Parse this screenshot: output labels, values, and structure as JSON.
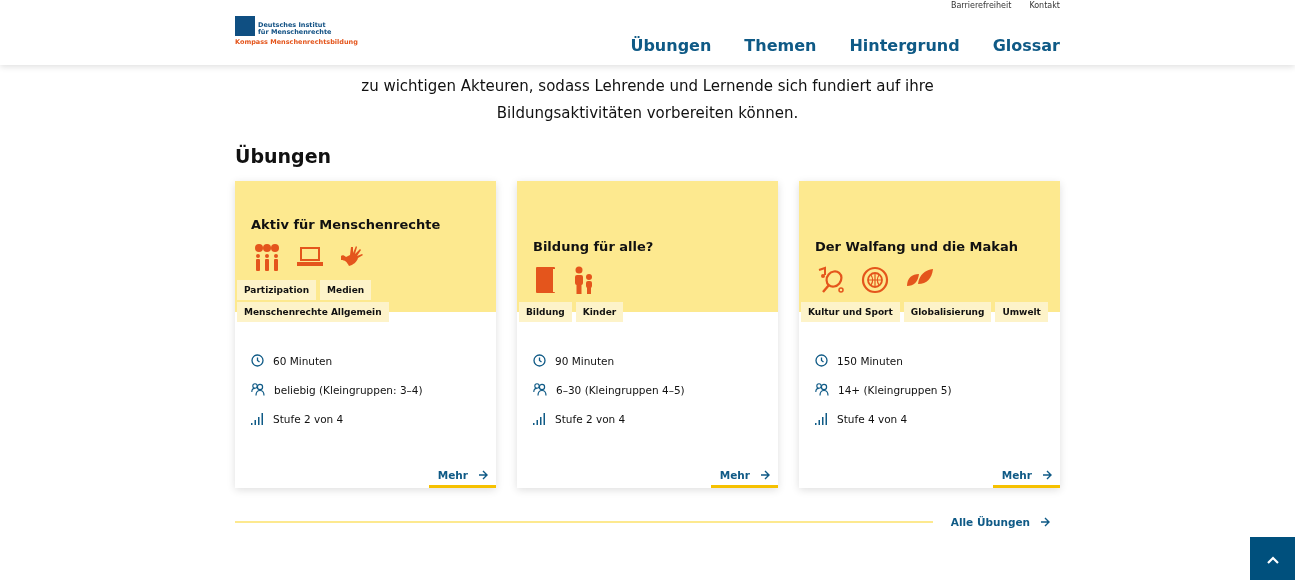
{
  "header": {
    "logo": {
      "line_1": "Deutsches Institut",
      "line_2": "für Menschenrechte",
      "subtitle": "Kompass Menschenrechtsbildung"
    },
    "utility_links": [
      "Barrierefreiheit",
      "Kontakt"
    ],
    "nav": [
      "Übungen",
      "Themen",
      "Hintergrund",
      "Glossar"
    ]
  },
  "intro": [
    "zu wichtigen Akteuren, sodass Lehrende und Lernende sich fundiert auf ihre",
    "Bildungsaktivitäten vorbereiten können."
  ],
  "section_title": "Übungen",
  "cards": [
    {
      "title": "Aktiv für Menschenrechte",
      "icons": [
        {
          "kind": "speakers"
        },
        {
          "kind": "laptop"
        },
        {
          "kind": "hand"
        }
      ],
      "tags": [
        "Partizipation",
        "Medien",
        "Menschenrechte Allgemein"
      ],
      "duration": "60 Minuten",
      "group": "beliebig (Kleingruppen: 3–4)",
      "level": "Stufe 2 von 4",
      "more": "Mehr"
    },
    {
      "title": "Bildung für alle?",
      "icons": [
        {
          "kind": "book"
        },
        {
          "kind": "children"
        }
      ],
      "tags": [
        "Bildung",
        "Kinder"
      ],
      "duration": "90 Minuten",
      "group": "6–30 (Kleingruppen 4–5)",
      "level": "Stufe 2 von 4",
      "more": "Mehr"
    },
    {
      "title": "Der Walfang und die Makah",
      "icons": [
        {
          "kind": "culture"
        },
        {
          "kind": "globe"
        },
        {
          "kind": "leaves"
        }
      ],
      "tags": [
        "Kultur und Sport",
        "Globalisierung",
        "Umwelt"
      ],
      "duration": "150 Minuten",
      "group": "14+ (Kleingruppen 5)",
      "level": "Stufe 4 von 4",
      "more": "Mehr"
    }
  ],
  "all_link": "Alle Übungen"
}
